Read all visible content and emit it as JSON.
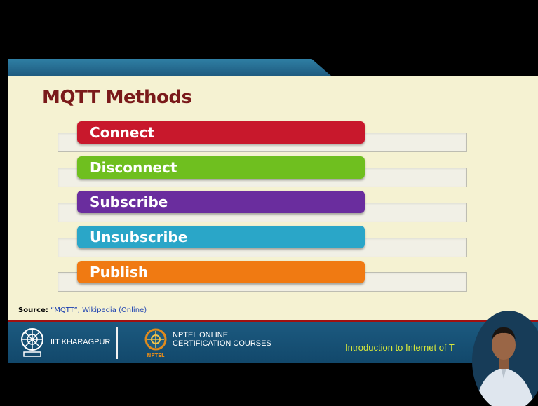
{
  "slide": {
    "title": "MQTT Methods",
    "methods": [
      {
        "label": "Connect",
        "color": "#c8182c"
      },
      {
        "label": "Disconnect",
        "color": "#6fbf1f"
      },
      {
        "label": "Subscribe",
        "color": "#6a2d9e"
      },
      {
        "label": "Unsubscribe",
        "color": "#2aa6c8"
      },
      {
        "label": "Publish",
        "color": "#f07a12"
      }
    ],
    "source_label": "Source:",
    "source_link_1": "“MQTT”, Wikipedia",
    "source_link_2": "(Online)"
  },
  "footer": {
    "institute": "IIT KHARAGPUR",
    "nptel_line1": "NPTEL ONLINE",
    "nptel_line2": "CERTIFICATION COURSES",
    "nptel_badge": "NPTEL",
    "course": "Introduction to Internet of T"
  },
  "colors": {
    "title": "#7a1a1a",
    "footer_bg": "#1c5a80",
    "course_text": "#d8e83a",
    "divider": "#a01010"
  }
}
